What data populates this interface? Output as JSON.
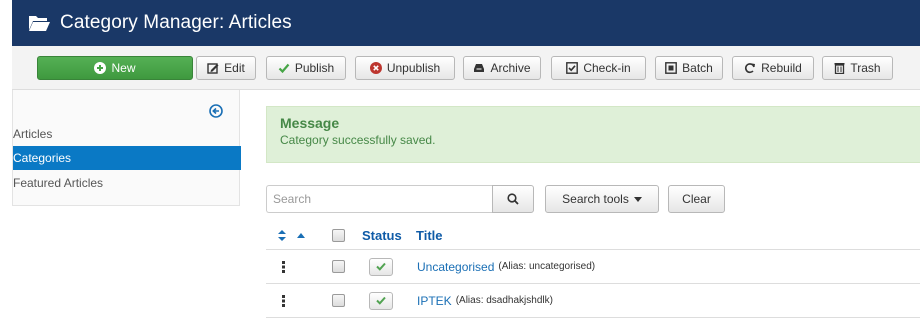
{
  "header": {
    "title": "Category Manager: Articles",
    "icon": "folder-open-icon"
  },
  "toolbar": {
    "new_label": "New",
    "edit_label": "Edit",
    "publish_label": "Publish",
    "unpublish_label": "Unpublish",
    "archive_label": "Archive",
    "checkin_label": "Check-in",
    "batch_label": "Batch",
    "rebuild_label": "Rebuild",
    "trash_label": "Trash"
  },
  "sidebar": {
    "items": [
      {
        "label": "Articles",
        "active": false
      },
      {
        "label": "Categories",
        "active": true
      },
      {
        "label": "Featured Articles",
        "active": false
      }
    ]
  },
  "message": {
    "heading": "Message",
    "text": "Category successfully saved."
  },
  "filters": {
    "search_placeholder": "Search",
    "search_value": "",
    "search_tools_label": "Search tools",
    "clear_label": "Clear"
  },
  "table": {
    "headers": {
      "status": "Status",
      "title": "Title"
    },
    "rows": [
      {
        "title": "Uncategorised",
        "alias": "(Alias: uncategorised)",
        "published": true
      },
      {
        "title": "IPTEK",
        "alias": "(Alias: dsadhakjshdlk)",
        "published": true
      }
    ]
  },
  "colors": {
    "header_bg": "#1a3867",
    "new_button": "#46a546",
    "active_nav": "#0a79c5",
    "message_bg": "#dff0d8",
    "message_text": "#468847",
    "link": "#1a6fb5",
    "published_check": "#51a351"
  }
}
